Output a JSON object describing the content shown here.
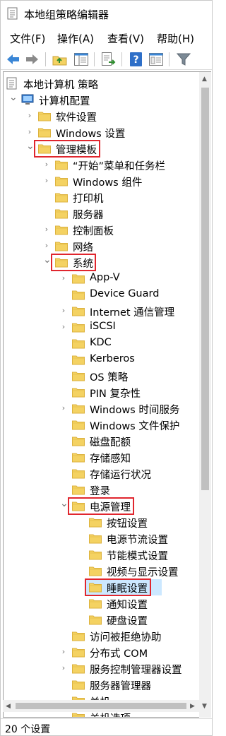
{
  "window": {
    "title": "本地组策略编辑器"
  },
  "menu": [
    "文件(F)",
    "操作(A)",
    "查看(V)",
    "帮助(H)"
  ],
  "toolbar": [
    "back-icon",
    "forward-icon",
    "up-folder-icon",
    "show-hide-tree-icon",
    "export-list-icon",
    "help-icon",
    "properties-icon",
    "filter-icon"
  ],
  "tree": [
    {
      "label": "本地计算机 策略",
      "level": 0,
      "icon": "policy-icon",
      "expander": ""
    },
    {
      "label": "计算机配置",
      "level": 1,
      "icon": "computer-icon",
      "expander": "open"
    },
    {
      "label": "软件设置",
      "level": 2,
      "icon": "folder-icon",
      "expander": "closed"
    },
    {
      "label": "Windows 设置",
      "level": 2,
      "icon": "folder-icon",
      "expander": "closed"
    },
    {
      "label": "管理模板",
      "level": 2,
      "icon": "folder-icon",
      "expander": "open",
      "highlight": true
    },
    {
      "label": "“开始”菜单和任务栏",
      "level": 3,
      "icon": "folder-icon",
      "expander": "closed"
    },
    {
      "label": "Windows 组件",
      "level": 3,
      "icon": "folder-icon",
      "expander": "closed"
    },
    {
      "label": "打印机",
      "level": 3,
      "icon": "folder-icon",
      "expander": ""
    },
    {
      "label": "服务器",
      "level": 3,
      "icon": "folder-icon",
      "expander": ""
    },
    {
      "label": "控制面板",
      "level": 3,
      "icon": "folder-icon",
      "expander": "closed"
    },
    {
      "label": "网络",
      "level": 3,
      "icon": "folder-icon",
      "expander": "closed"
    },
    {
      "label": "系统",
      "level": 3,
      "icon": "folder-icon",
      "expander": "open",
      "highlight": true
    },
    {
      "label": "App-V",
      "level": 4,
      "icon": "folder-icon",
      "expander": "closed"
    },
    {
      "label": "Device Guard",
      "level": 4,
      "icon": "folder-icon",
      "expander": ""
    },
    {
      "label": "Internet 通信管理",
      "level": 4,
      "icon": "folder-icon",
      "expander": "closed"
    },
    {
      "label": "iSCSI",
      "level": 4,
      "icon": "folder-icon",
      "expander": "closed"
    },
    {
      "label": "KDC",
      "level": 4,
      "icon": "folder-icon",
      "expander": ""
    },
    {
      "label": "Kerberos",
      "level": 4,
      "icon": "folder-icon",
      "expander": ""
    },
    {
      "label": "OS 策略",
      "level": 4,
      "icon": "folder-icon",
      "expander": ""
    },
    {
      "label": "PIN 复杂性",
      "level": 4,
      "icon": "folder-icon",
      "expander": ""
    },
    {
      "label": "Windows 时间服务",
      "level": 4,
      "icon": "folder-icon",
      "expander": "closed"
    },
    {
      "label": "Windows 文件保护",
      "level": 4,
      "icon": "folder-icon",
      "expander": ""
    },
    {
      "label": "磁盘配额",
      "level": 4,
      "icon": "folder-icon",
      "expander": ""
    },
    {
      "label": "存储感知",
      "level": 4,
      "icon": "folder-icon",
      "expander": ""
    },
    {
      "label": "存储运行状况",
      "level": 4,
      "icon": "folder-icon",
      "expander": ""
    },
    {
      "label": "登录",
      "level": 4,
      "icon": "folder-icon",
      "expander": ""
    },
    {
      "label": "电源管理",
      "level": 4,
      "icon": "folder-icon",
      "expander": "open",
      "highlight": true
    },
    {
      "label": "按钮设置",
      "level": 5,
      "icon": "folder-icon",
      "expander": ""
    },
    {
      "label": "电源节流设置",
      "level": 5,
      "icon": "folder-icon",
      "expander": ""
    },
    {
      "label": "节能模式设置",
      "level": 5,
      "icon": "folder-icon",
      "expander": ""
    },
    {
      "label": "视频与显示设置",
      "level": 5,
      "icon": "folder-icon",
      "expander": ""
    },
    {
      "label": "睡眠设置",
      "level": 5,
      "icon": "folder-icon",
      "expander": "",
      "highlight": true,
      "selected": true
    },
    {
      "label": "通知设置",
      "level": 5,
      "icon": "folder-icon",
      "expander": ""
    },
    {
      "label": "硬盘设置",
      "level": 5,
      "icon": "folder-icon",
      "expander": ""
    },
    {
      "label": "访问被拒绝协助",
      "level": 4,
      "icon": "folder-icon",
      "expander": ""
    },
    {
      "label": "分布式 COM",
      "level": 4,
      "icon": "folder-icon",
      "expander": "closed"
    },
    {
      "label": "服务控制管理器设置",
      "level": 4,
      "icon": "folder-icon",
      "expander": "closed"
    },
    {
      "label": "服务器管理器",
      "level": 4,
      "icon": "folder-icon",
      "expander": ""
    },
    {
      "label": "关机",
      "level": 4,
      "icon": "folder-icon",
      "expander": ""
    },
    {
      "label": "关机选项",
      "level": 4,
      "icon": "folder-icon",
      "expander": ""
    }
  ],
  "status": {
    "text": "20 个设置"
  },
  "colors": {
    "accent_highlight": "#e0262e",
    "selection": "#cce8ff",
    "folder": "#f4d262",
    "folder_dark": "#dcb23e"
  }
}
